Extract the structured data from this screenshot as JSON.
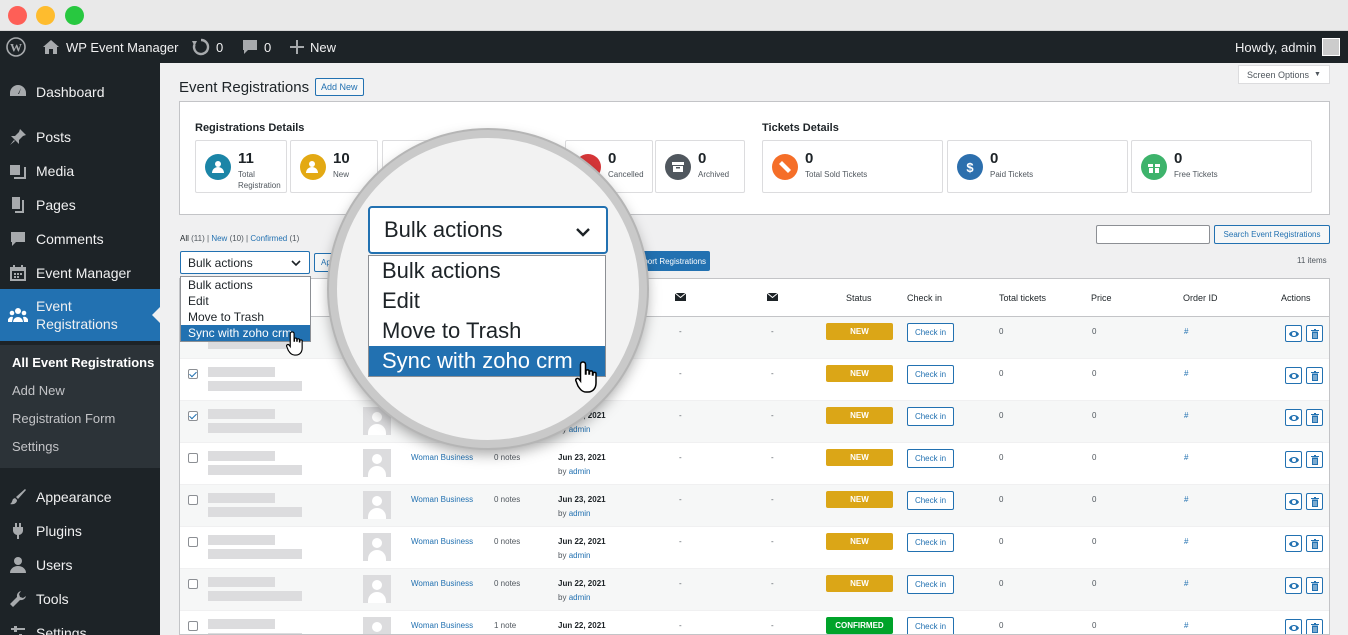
{
  "adminbar": {
    "site_name": "WP Event Manager",
    "updates_count": "0",
    "comments_count": "0",
    "new_label": "New",
    "greeting": "Howdy, admin"
  },
  "sidebar": {
    "items": [
      {
        "label": "Dashboard",
        "icon": "dashboard-icon"
      },
      {
        "label": "Posts",
        "icon": "pin-icon"
      },
      {
        "label": "Media",
        "icon": "media-icon"
      },
      {
        "label": "Pages",
        "icon": "page-icon"
      },
      {
        "label": "Comments",
        "icon": "comment-icon"
      },
      {
        "label": "Event Manager",
        "icon": "calendar-icon"
      },
      {
        "label_line1": "Event",
        "label_line2": "Registrations",
        "icon": "groups-icon"
      },
      {
        "label": "Appearance",
        "icon": "brush-icon"
      },
      {
        "label": "Plugins",
        "icon": "plugin-icon"
      },
      {
        "label": "Users",
        "icon": "user-icon"
      },
      {
        "label": "Tools",
        "icon": "wrench-icon"
      },
      {
        "label": "Settings",
        "icon": "settings-icon"
      }
    ],
    "submenu": [
      "All Event Registrations",
      "Add New",
      "Registration Form",
      "Settings"
    ]
  },
  "screen_options": "Screen Options",
  "page": {
    "title": "Event Registrations",
    "add_new": "Add New"
  },
  "registration_details": {
    "heading": "Registrations Details",
    "cards": [
      {
        "value": "11",
        "label": "Total Registration",
        "color": "#1b85a7"
      },
      {
        "value": "10",
        "label": "New",
        "color": "#e3a913"
      },
      {
        "value": "0",
        "label": "Cancelled",
        "color": "#d63638"
      },
      {
        "value": "0",
        "label": "Archived",
        "color": "#50575e"
      }
    ]
  },
  "tickets_details": {
    "heading": "Tickets Details",
    "cards": [
      {
        "value": "0",
        "label": "Total Sold Tickets",
        "color": "#f56e28"
      },
      {
        "value": "0",
        "label": "Paid Tickets",
        "color": "#2c6fad"
      },
      {
        "value": "0",
        "label": "Free Tickets",
        "color": "#3db36b"
      }
    ]
  },
  "filters": {
    "all": "All",
    "all_count": "(11)",
    "new": "New",
    "new_count": "(10)",
    "confirmed": "Confirmed",
    "confirmed_count": "(1)",
    "sep": "|"
  },
  "bulk": {
    "selected": "Bulk actions",
    "options": [
      "Bulk actions",
      "Edit",
      "Move to Trash",
      "Sync with zoho crm"
    ],
    "apply": "Apply",
    "export": "Export Registrations"
  },
  "search": {
    "button": "Search Event Registrations",
    "items_count": "11 items"
  },
  "table": {
    "headers": {
      "status": "Status",
      "check_in": "Check in",
      "total_tickets": "Total tickets",
      "price": "Price",
      "order_id": "Order ID",
      "actions": "Actions"
    },
    "rows": [
      {
        "checked": false,
        "event": "",
        "notes": "",
        "date": "",
        "by_prefix": "",
        "by": "",
        "d1": "-",
        "d2": "-",
        "status": "NEW",
        "status_type": "new",
        "checkin": "Check in",
        "tickets": "0",
        "price": "0",
        "order": "#"
      },
      {
        "checked": true,
        "event": "",
        "notes": "",
        "date": "",
        "by_prefix": "",
        "by": "",
        "d1": "-",
        "d2": "-",
        "status": "NEW",
        "status_type": "new",
        "checkin": "Check in",
        "tickets": "0",
        "price": "0",
        "order": "#"
      },
      {
        "checked": true,
        "event": "",
        "notes": "",
        "date": "Jun 23, 2021",
        "by_prefix": "by",
        "by": "admin",
        "d1": "-",
        "d2": "-",
        "status": "NEW",
        "status_type": "new",
        "checkin": "Check in",
        "tickets": "0",
        "price": "0",
        "order": "#"
      },
      {
        "checked": false,
        "event": "Woman Business",
        "notes": "0 notes",
        "date": "Jun 23, 2021",
        "by_prefix": "by",
        "by": "admin",
        "d1": "-",
        "d2": "-",
        "status": "NEW",
        "status_type": "new",
        "checkin": "Check in",
        "tickets": "0",
        "price": "0",
        "order": "#"
      },
      {
        "checked": false,
        "event": "Woman Business",
        "notes": "0 notes",
        "date": "Jun 23, 2021",
        "by_prefix": "by",
        "by": "admin",
        "d1": "-",
        "d2": "-",
        "status": "NEW",
        "status_type": "new",
        "checkin": "Check in",
        "tickets": "0",
        "price": "0",
        "order": "#"
      },
      {
        "checked": false,
        "event": "Woman Business",
        "notes": "0 notes",
        "date": "Jun 22, 2021",
        "by_prefix": "by",
        "by": "admin",
        "d1": "-",
        "d2": "-",
        "status": "NEW",
        "status_type": "new",
        "checkin": "Check in",
        "tickets": "0",
        "price": "0",
        "order": "#"
      },
      {
        "checked": false,
        "event": "Woman Business",
        "notes": "0 notes",
        "date": "Jun 22, 2021",
        "by_prefix": "by",
        "by": "admin",
        "d1": "-",
        "d2": "-",
        "status": "NEW",
        "status_type": "new",
        "checkin": "Check in",
        "tickets": "0",
        "price": "0",
        "order": "#"
      },
      {
        "checked": false,
        "event": "Woman Business",
        "notes": "1 note",
        "date": "Jun 22, 2021",
        "by_prefix": "",
        "by": "",
        "d1": "-",
        "d2": "-",
        "status": "CONFIRMED",
        "status_type": "confirmed",
        "checkin": "Check in",
        "tickets": "0",
        "price": "0",
        "order": "#"
      }
    ]
  },
  "magnifier": {
    "selected": "Bulk actions",
    "options": [
      "Bulk actions",
      "Edit",
      "Move to Trash",
      "Sync with zoho crm"
    ]
  }
}
